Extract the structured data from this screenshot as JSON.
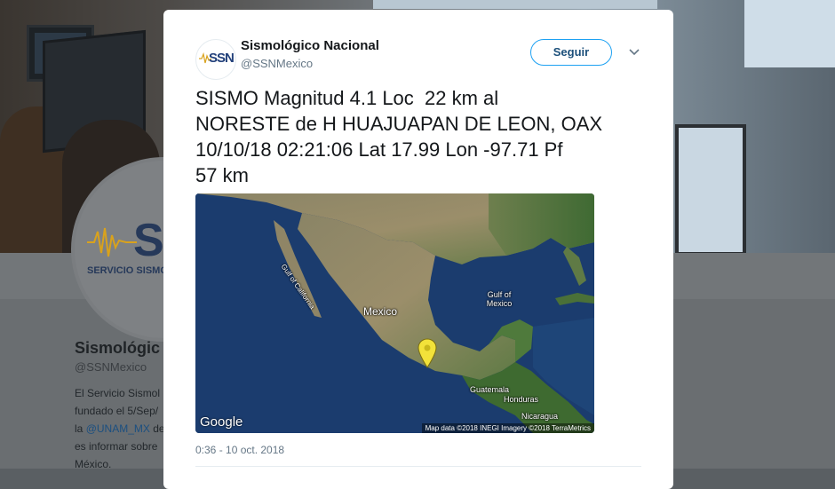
{
  "background_profile": {
    "avatar_text": "SSN",
    "avatar_subtext": "SERVICIO SISMOLÓGIC",
    "name": "Sismológic",
    "handle": "@SSNMexico",
    "bio_lines": [
      "El Servicio Sismol",
      "fundado el 5/Sep/",
      "la ",
      "es informar sobre",
      "México."
    ],
    "bio_link": "@UNAM_MX",
    "bio_link_suffix": " de"
  },
  "tweet": {
    "avatar_text": "SSN",
    "display_name": "Sismológico Nacional",
    "handle": "@SSNMexico",
    "follow_label": "Seguir",
    "menu_icon": "chevron-down-icon",
    "text": "SISMO Magnitud 4.1 Loc  22 km al\nNORESTE de H HUAJUAPAN DE LEON, OAX\n10/10/18 02:21:06 Lat 17.99 Lon -97.71 Pf\n57 km",
    "timestamp": "0:36 - 10 oct. 2018"
  },
  "map": {
    "label_mexico": "Mexico",
    "label_gulf": "Gulf of Mexico",
    "label_guatemala": "Guatemala",
    "label_honduras": "Honduras",
    "label_nicaragua": "Nicaragua",
    "label_gulf_california": "Gulf of California",
    "logo": "Google",
    "attribution": "Map data ©2018 INEGI  Imagery ©2018 TerraMetrics",
    "pin_color": "#f2e23a"
  },
  "colors": {
    "accent": "#1da1f2",
    "text": "#14171a",
    "muted": "#657786"
  }
}
